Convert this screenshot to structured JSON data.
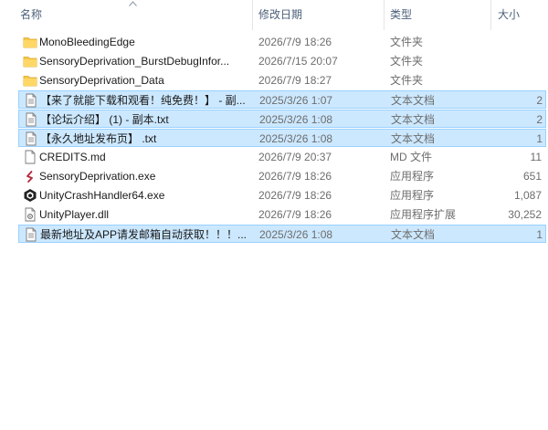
{
  "columns": {
    "name": "名称",
    "date": "修改日期",
    "type": "类型",
    "size": "大小"
  },
  "files": [
    {
      "name": "MonoBleedingEdge",
      "date": "2026/7/9 18:26",
      "type": "文件夹",
      "size": "",
      "icon": "folder-icon",
      "selected": false
    },
    {
      "name": "SensoryDeprivation_BurstDebugInfor...",
      "date": "2026/7/15 20:07",
      "type": "文件夹",
      "size": "",
      "icon": "folder-icon",
      "selected": false
    },
    {
      "name": "SensoryDeprivation_Data",
      "date": "2026/7/9 18:27",
      "type": "文件夹",
      "size": "",
      "icon": "folder-icon",
      "selected": false
    },
    {
      "name": "【来了就能下载和观看！纯免费！】 - 副...",
      "date": "2025/3/26 1:07",
      "type": "文本文档",
      "size": "2",
      "icon": "text-file-icon",
      "selected": true
    },
    {
      "name": "【论坛介绍】 (1) - 副本.txt",
      "date": "2025/3/26 1:08",
      "type": "文本文档",
      "size": "2",
      "icon": "text-file-icon",
      "selected": true
    },
    {
      "name": "【永久地址发布页】 .txt",
      "date": "2025/3/26 1:08",
      "type": "文本文档",
      "size": "1",
      "icon": "text-file-icon",
      "selected": true
    },
    {
      "name": "CREDITS.md",
      "date": "2026/7/9 20:37",
      "type": "MD 文件",
      "size": "11",
      "icon": "file-icon",
      "selected": false
    },
    {
      "name": "SensoryDeprivation.exe",
      "date": "2026/7/9 18:26",
      "type": "应用程序",
      "size": "651",
      "icon": "app-icon",
      "selected": false
    },
    {
      "name": "UnityCrashHandler64.exe",
      "date": "2026/7/9 18:26",
      "type": "应用程序",
      "size": "1,087",
      "icon": "unity-icon",
      "selected": false
    },
    {
      "name": "UnityPlayer.dll",
      "date": "2026/7/9 18:26",
      "type": "应用程序扩展",
      "size": "30,252",
      "icon": "dll-icon",
      "selected": false
    },
    {
      "name": "最新地址及APP请发邮箱自动获取！！！...",
      "date": "2025/3/26 1:08",
      "type": "文本文档",
      "size": "1",
      "icon": "text-file-icon",
      "selected": true
    }
  ]
}
